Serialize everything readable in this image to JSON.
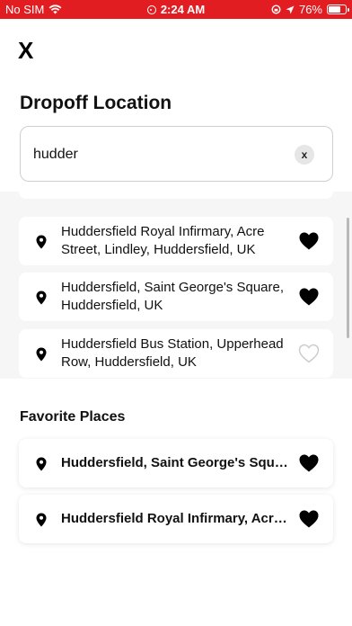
{
  "status_bar": {
    "carrier": "No SIM",
    "time": "2:24 AM",
    "battery": "76%",
    "battery_level": 0.76,
    "background_color": "#e11d22"
  },
  "close_label": "X",
  "title": "Dropoff Location",
  "search": {
    "value": "hudder",
    "clear_label": "x"
  },
  "results": [
    {
      "text": "Huddersfield Royal Infirmary, Acre Street, Lindley, Huddersfield, UK",
      "favorite": true,
      "icon": "location-pin-icon"
    },
    {
      "text": "Huddersfield, Saint George's Square, Huddersfield, UK",
      "favorite": true,
      "icon": "location-pin-icon"
    },
    {
      "text": "Huddersfield Bus Station, Upperhead Row, Huddersfield, UK",
      "favorite": false,
      "icon": "location-pin-icon"
    }
  ],
  "favorites": {
    "heading": "Favorite Places",
    "items": [
      {
        "text": "Huddersfield, Saint George's Square, Huddersfield, UK",
        "favorite": true
      },
      {
        "text": "Huddersfield Royal Infirmary, Acre Street, Lindley, Huddersfield, UK",
        "favorite": true
      }
    ]
  }
}
